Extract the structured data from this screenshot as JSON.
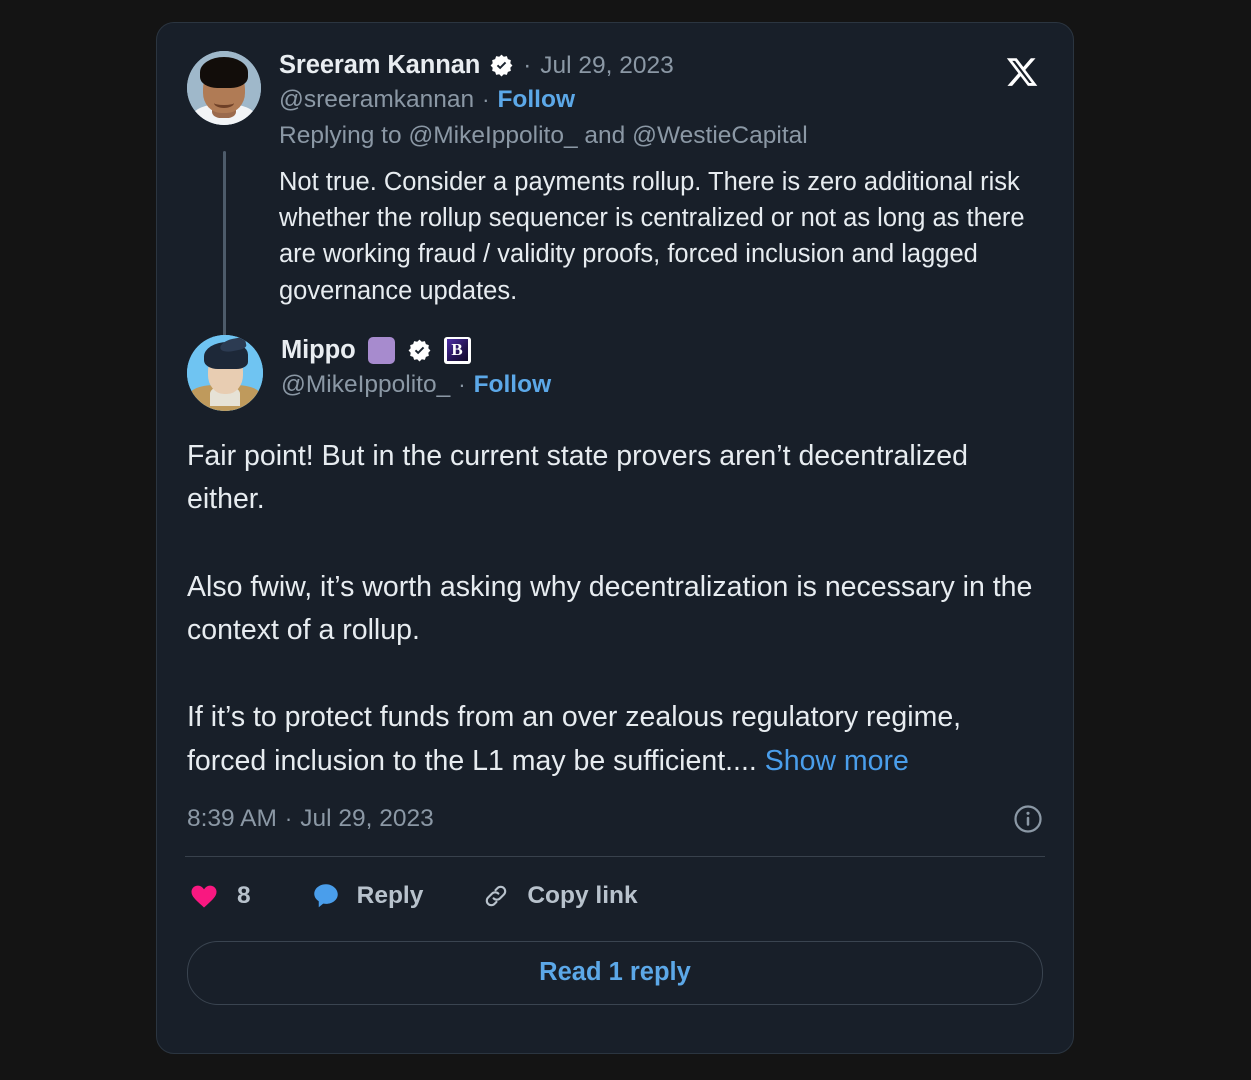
{
  "platform": {
    "logo": "x-logo"
  },
  "parent_tweet": {
    "display_name": "Sreeram Kannan",
    "verified": true,
    "separator": "·",
    "date": "Jul 29, 2023",
    "handle": "@sreeramkannan",
    "follow_label": "Follow",
    "replying_prefix": "Replying to ",
    "replying_to_1": "@MikeIppolito_",
    "replying_conj": " and ",
    "replying_to_2": "@WestieCapital",
    "body": "Not true. Consider a payments rollup. There is zero additional risk whether the rollup sequencer is centralized or not as long as there are working fraud / validity proofs, forced inclusion and lagged governance updates."
  },
  "main_tweet": {
    "display_name": "Mippo",
    "emoji_badge": "purple-square",
    "verified": true,
    "org_badge_letter": "B",
    "handle": "@MikeIppolito_",
    "separator": "·",
    "follow_label": "Follow",
    "body": "Fair point! But in the current state provers aren’t decentralized either.\n\nAlso fwiw, it’s worth asking why decentralization is necessary in the context of a rollup.\n\nIf it’s to protect funds from an over zealous regulatory regime, forced inclusion to the L1 may be sufficient....",
    "show_more_label": "Show more",
    "time": "8:39 AM",
    "time_separator": "·",
    "date": "Jul 29, 2023",
    "info_icon": "info-circle-icon"
  },
  "actions": {
    "like_icon": "heart-icon",
    "like_count": "8",
    "reply_icon": "speech-bubble-icon",
    "reply_label": "Reply",
    "copy_icon": "link-chain-icon",
    "copy_label": "Copy link"
  },
  "read_reply": {
    "label": "Read 1 reply"
  },
  "colors": {
    "page_background": "#141414",
    "card_background": "#181f29",
    "card_border": "#2b3540",
    "primary_text": "#e7ecf0",
    "muted_text": "#8b98a5",
    "link_blue": "#5ca8e8",
    "like_pink": "#f91880",
    "reply_blue": "#4a9eeb",
    "emoji_purple": "#a78bce"
  }
}
